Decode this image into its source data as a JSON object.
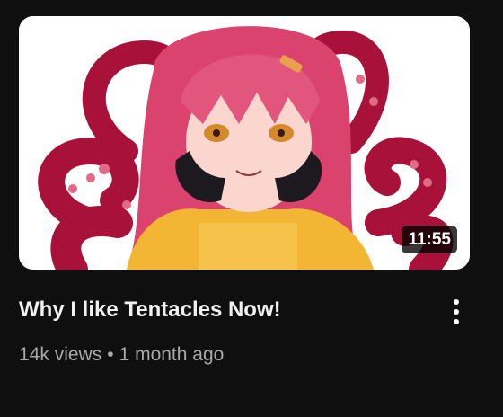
{
  "video": {
    "title": "Why I like Tentacles Now!",
    "duration": "11:55",
    "views": "14k views",
    "separator": "•",
    "age": "1 month ago",
    "thumbnail_subject": "anime girl with pink hair and tentacles"
  },
  "icons": {
    "menu": "more-vert-icon"
  },
  "colors": {
    "background": "#0f0f0f",
    "title_text": "#f1f1f1",
    "meta_text": "#aaaaaa",
    "hair": "#e2557c",
    "tentacle": "#b0143a",
    "jacket": "#f2b534"
  }
}
